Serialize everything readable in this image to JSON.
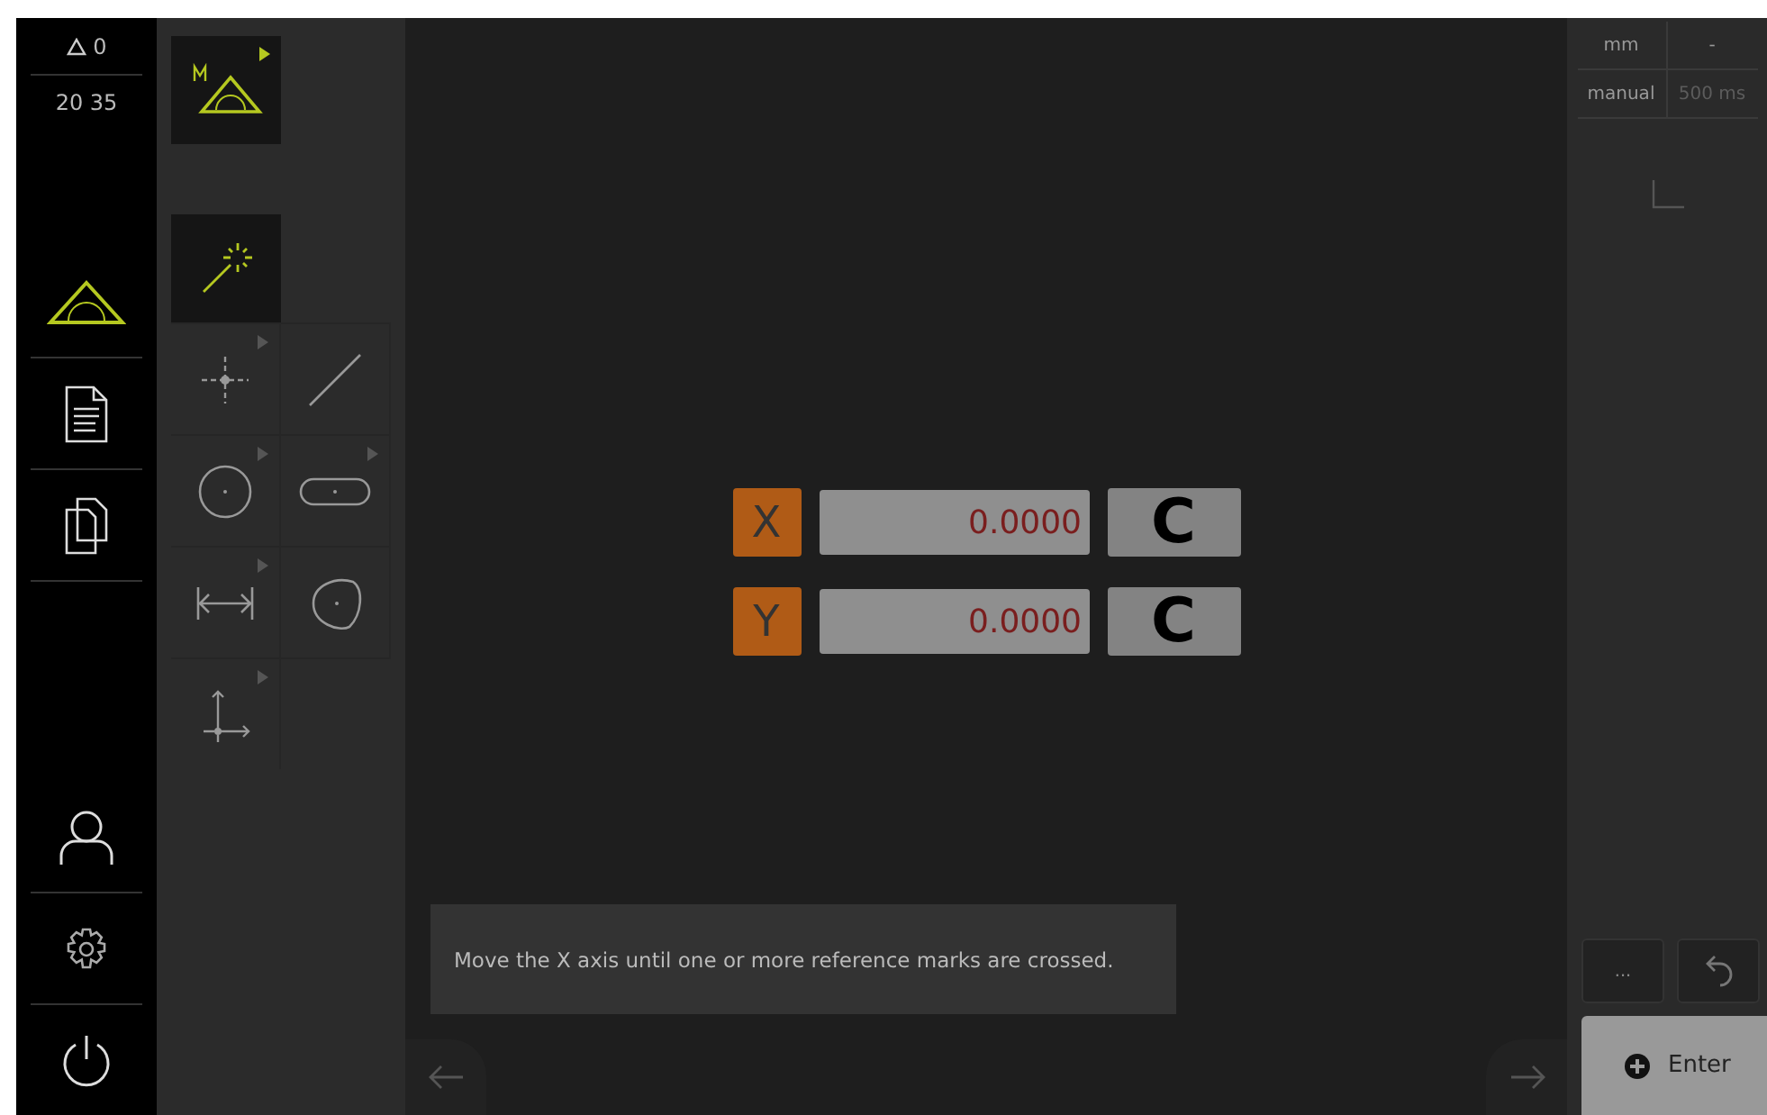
{
  "status": {
    "warnings": "0",
    "time": "20 35"
  },
  "nav_items": [
    {
      "kind": "measure",
      "selected": true
    },
    {
      "kind": "report",
      "selected": false
    },
    {
      "kind": "files",
      "selected": false
    }
  ],
  "nav_bottom": [
    {
      "kind": "user"
    },
    {
      "kind": "settings"
    },
    {
      "kind": "power"
    }
  ],
  "mode_button": {
    "has_menu": true
  },
  "tools": [
    {
      "kind": "auto",
      "selected": true,
      "has_menu": false
    },
    {
      "kind": "point",
      "selected": false,
      "has_menu": true
    },
    {
      "kind": "line",
      "selected": false,
      "has_menu": false
    },
    {
      "kind": "circle",
      "selected": false,
      "has_menu": true
    },
    {
      "kind": "slot",
      "selected": false,
      "has_menu": true
    },
    {
      "kind": "distance",
      "selected": false,
      "has_menu": true
    },
    {
      "kind": "blob",
      "selected": false,
      "has_menu": false
    },
    {
      "kind": "origin",
      "selected": false,
      "has_menu": true
    }
  ],
  "axes": [
    {
      "label": "X",
      "value": "0.0000",
      "clear": "C"
    },
    {
      "label": "Y",
      "value": "0.0000",
      "clear": "C"
    }
  ],
  "message": "Move the X axis until one or more reference marks are crossed.",
  "settings": [
    {
      "text": "mm",
      "disabled": false
    },
    {
      "text": "-",
      "disabled": false
    },
    {
      "text": "manual",
      "disabled": false
    },
    {
      "text": "500 ms",
      "disabled": true
    }
  ],
  "more_button": "...",
  "enter_button": "Enter"
}
